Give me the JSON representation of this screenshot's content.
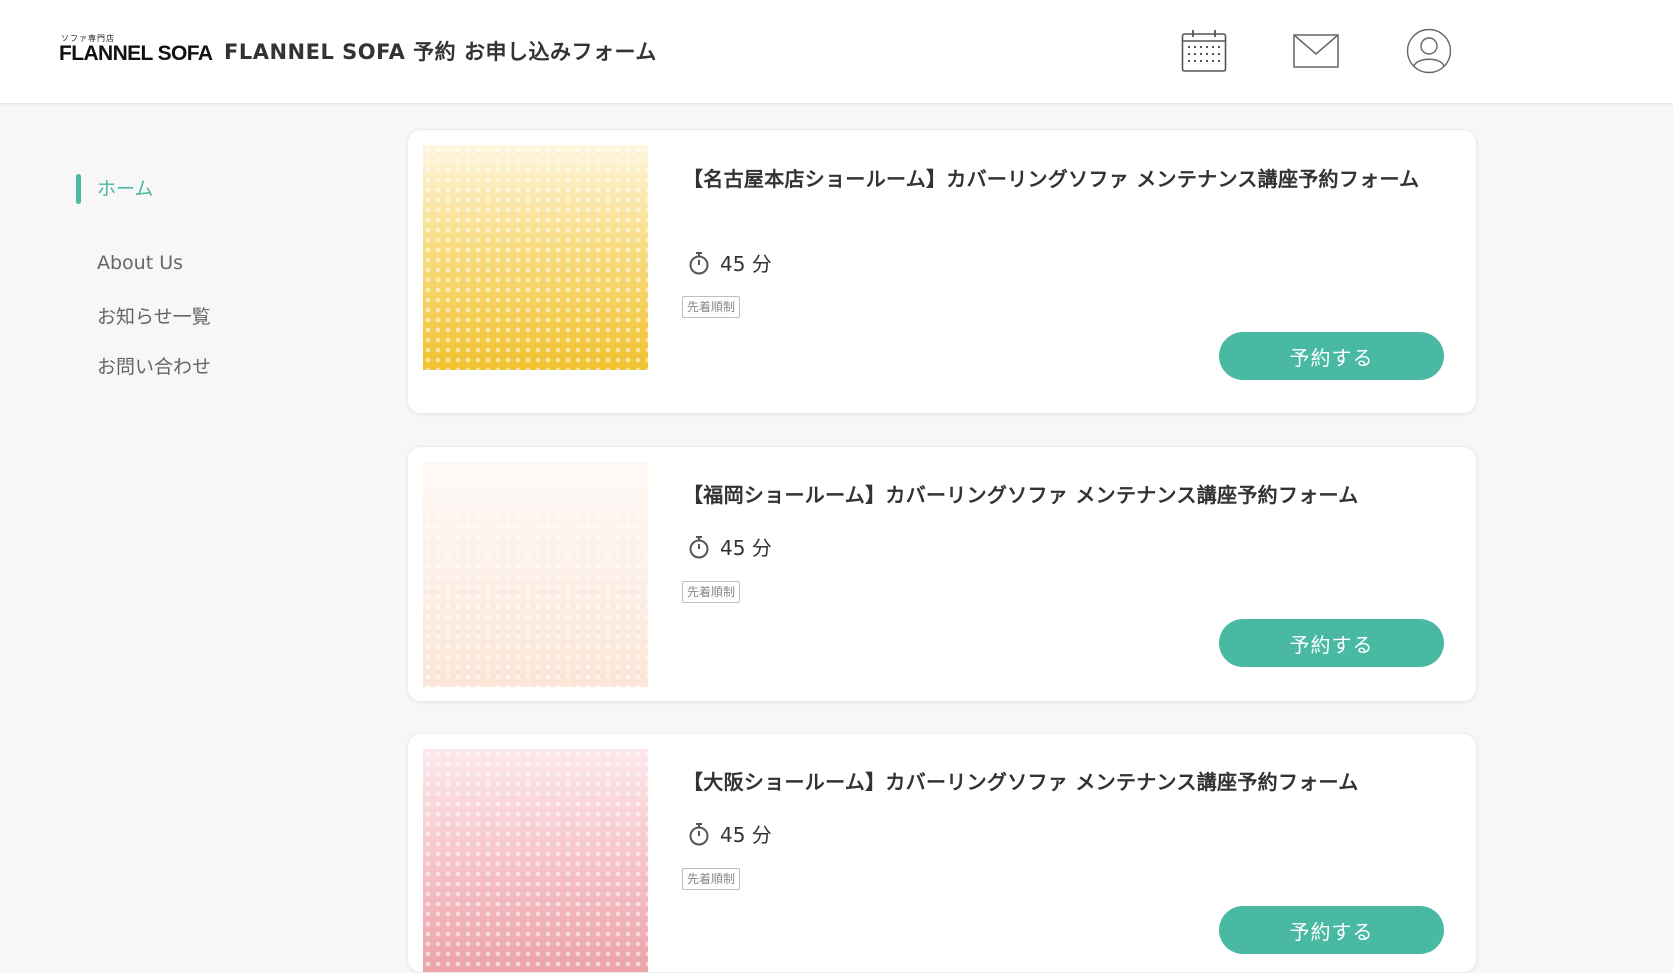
{
  "header": {
    "logo_small": "ソファ専門店",
    "logo_main": "FLANNEL SOFA",
    "title": "FLANNEL SOFA 予約 お申し込みフォーム",
    "icons": [
      "calendar-icon",
      "mail-icon",
      "user-icon"
    ]
  },
  "sidebar": {
    "items": [
      {
        "label": "ホーム",
        "active": true
      },
      {
        "label": "About Us"
      },
      {
        "label": "お知らせ一覧"
      },
      {
        "label": "お問い合わせ"
      }
    ]
  },
  "cards": [
    {
      "title": "【名古屋本店ショールーム】カバーリングソファ メンテナンス講座予約フォーム",
      "duration": "45 分",
      "tag": "先着順制",
      "button": "予約する",
      "thumb_color": "#f1c22f"
    },
    {
      "title": "【福岡ショールーム】カバーリングソファ メンテナンス講座予約フォーム",
      "duration": "45 分",
      "tag": "先着順制",
      "button": "予約する",
      "thumb_color": "#fbe6d7"
    },
    {
      "title": "【大阪ショールーム】カバーリングソファ メンテナンス講座予約フォーム",
      "duration": "45 分",
      "tag": "先着順制",
      "button": "予約する",
      "thumb_color": "#eba3a8"
    }
  ],
  "colors": {
    "accent": "#49b9a4",
    "text": "#333333",
    "muted": "#666666"
  }
}
